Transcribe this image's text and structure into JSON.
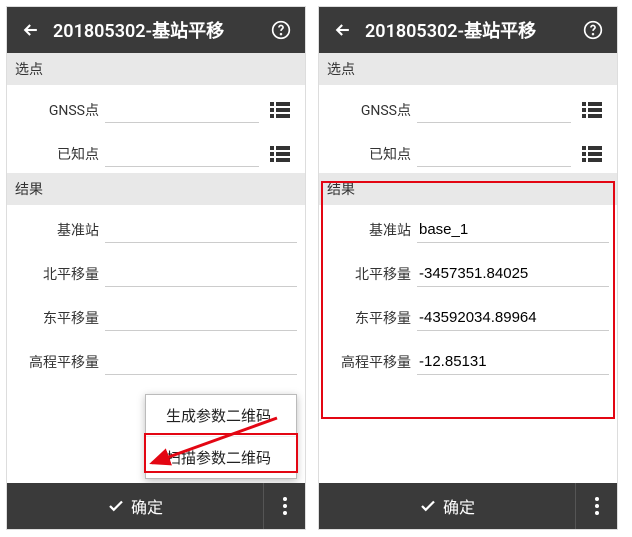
{
  "header": {
    "title": "201805302-基站平移"
  },
  "sections": {
    "select_point": "选点",
    "result": "结果"
  },
  "fields": {
    "gnss_label": "GNSS点",
    "known_label": "已知点",
    "base_label": "基准站",
    "north_label": "北平移量",
    "east_label": "东平移量",
    "height_label": "高程平移量"
  },
  "left": {
    "base_value": "",
    "north_value": "",
    "east_value": "",
    "height_value": ""
  },
  "right": {
    "base_value": "base_1",
    "north_value": "-3457351.84025",
    "east_value": "-43592034.89964",
    "height_value": "-12.85131"
  },
  "popup": {
    "generate_qr": "生成参数二维码",
    "scan_qr": "扫描参数二维码"
  },
  "footer": {
    "confirm": "确定"
  }
}
